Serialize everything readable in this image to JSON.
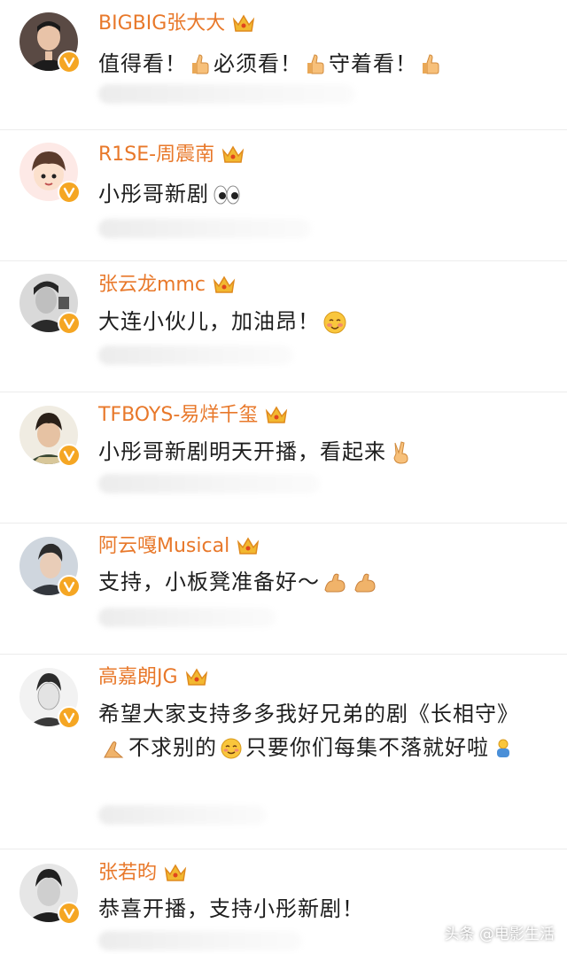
{
  "comments": [
    {
      "username": "BIGBIG张大大",
      "text": [
        "值得看！",
        "必须看！",
        "守着看！"
      ],
      "avatar": "avatar-zhang-dada",
      "badge": "verified-v-badge",
      "crown": "crown-icon"
    },
    {
      "username": "R1SE-周震南",
      "text": [
        "小彤哥新剧"
      ],
      "avatar": "avatar-zhou-zhennan",
      "badge": "verified-v-badge",
      "crown": "crown-icon"
    },
    {
      "username": "张云龙mmc",
      "text": [
        "大连小伙儿，加油昂！"
      ],
      "avatar": "avatar-zhang-yunlong",
      "badge": "verified-v-badge",
      "crown": "crown-icon"
    },
    {
      "username": "TFBOYS-易烊千玺",
      "text": [
        "小彤哥新剧明天开播，看起来"
      ],
      "avatar": "avatar-yi-yangqianxi",
      "badge": "verified-v-badge",
      "crown": "crown-icon"
    },
    {
      "username": "阿云嘎Musical",
      "text": [
        "支持，小板凳准备好～"
      ],
      "avatar": "avatar-a-yunga",
      "badge": "verified-v-badge",
      "crown": "crown-icon"
    },
    {
      "username": "高嘉朗JG",
      "text": [
        "希望大家支持多多我好兄弟的剧《长相守》",
        "不求别的",
        "只要你们每集不落就好啦"
      ],
      "avatar": "avatar-gao-jialang",
      "badge": "verified-v-badge",
      "crown": "crown-icon"
    },
    {
      "username": "张若昀",
      "text": [
        "恭喜开播，支持小彤新剧！"
      ],
      "avatar": "avatar-zhang-ruoyun",
      "badge": "verified-v-badge",
      "crown": "crown-icon"
    }
  ],
  "emoji": {
    "thumbs_up": "thumbs-up-emoji",
    "eyes": "eyes-emoji",
    "blushing": "blushing-face-emoji",
    "victory": "victory-hand-emoji",
    "muscle": "flexed-biceps-emoji",
    "praying": "folded-hands-emoji",
    "smile": "smiling-face-emoji",
    "hug": "hugging-person-emoji"
  },
  "watermark": "头条 @电影生活",
  "colors": {
    "username": "#e8782a",
    "text": "#1e1e1e",
    "badge": "#f5a623",
    "crown": "#f2b830",
    "divider": "#ececec"
  }
}
